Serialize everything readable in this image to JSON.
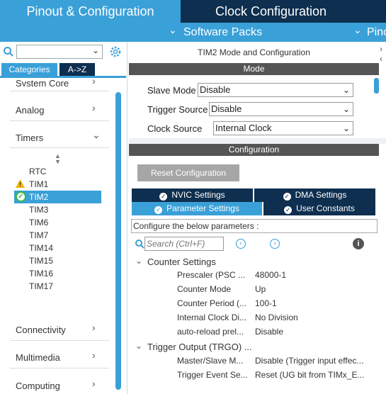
{
  "tabs": {
    "pinout": "Pinout & Configuration",
    "clock": "Clock Configuration"
  },
  "subbar": {
    "software_packs": "Software Packs",
    "pinout_short": "Pino"
  },
  "left": {
    "categories_tab": "Categories",
    "az_tab": "A->Z",
    "cat_system_core": "System Core",
    "cat_analog": "Analog",
    "cat_timers": "Timers",
    "cat_connectivity": "Connectivity",
    "cat_multimedia": "Multimedia",
    "cat_computing": "Computing",
    "timers": [
      "RTC",
      "TIM1",
      "TIM2",
      "TIM3",
      "TIM6",
      "TIM7",
      "TIM14",
      "TIM15",
      "TIM16",
      "TIM17"
    ]
  },
  "right": {
    "title": "TIM2 Mode and Configuration",
    "mode_header": "Mode",
    "slave_mode_label": "Slave Mode",
    "slave_mode_value": "Disable",
    "trigger_source_label": "Trigger Source",
    "trigger_source_value": "Disable",
    "clock_source_label": "Clock Source",
    "clock_source_value": "Internal Clock",
    "config_header": "Configuration",
    "reset_button": "Reset Configuration",
    "tab_nvic": "NVIC Settings",
    "tab_dma": "DMA Settings",
    "tab_params": "Parameter Settings",
    "tab_user": "User Constants",
    "configure_text": "Configure the below parameters :",
    "search_placeholder": "Search (Ctrl+F)",
    "counter_settings": "Counter Settings",
    "trigger_output": "Trigger Output (TRGO) ...",
    "params": [
      {
        "name": "Prescaler (PSC ...",
        "value": "48000-1"
      },
      {
        "name": "Counter Mode",
        "value": "Up"
      },
      {
        "name": "Counter Period (...",
        "value": "100-1"
      },
      {
        "name": "Internal Clock Di...",
        "value": "No Division"
      },
      {
        "name": "auto-reload prel...",
        "value": "Disable"
      }
    ],
    "trgo_params": [
      {
        "name": "Master/Slave M...",
        "value": "Disable (Trigger input effec..."
      },
      {
        "name": "Trigger Event Se...",
        "value": "Reset (UG bit from TIMx_E..."
      }
    ]
  },
  "colors": {
    "accent": "#3aa0d8",
    "dark": "#0e2f4f",
    "header": "#555555"
  }
}
